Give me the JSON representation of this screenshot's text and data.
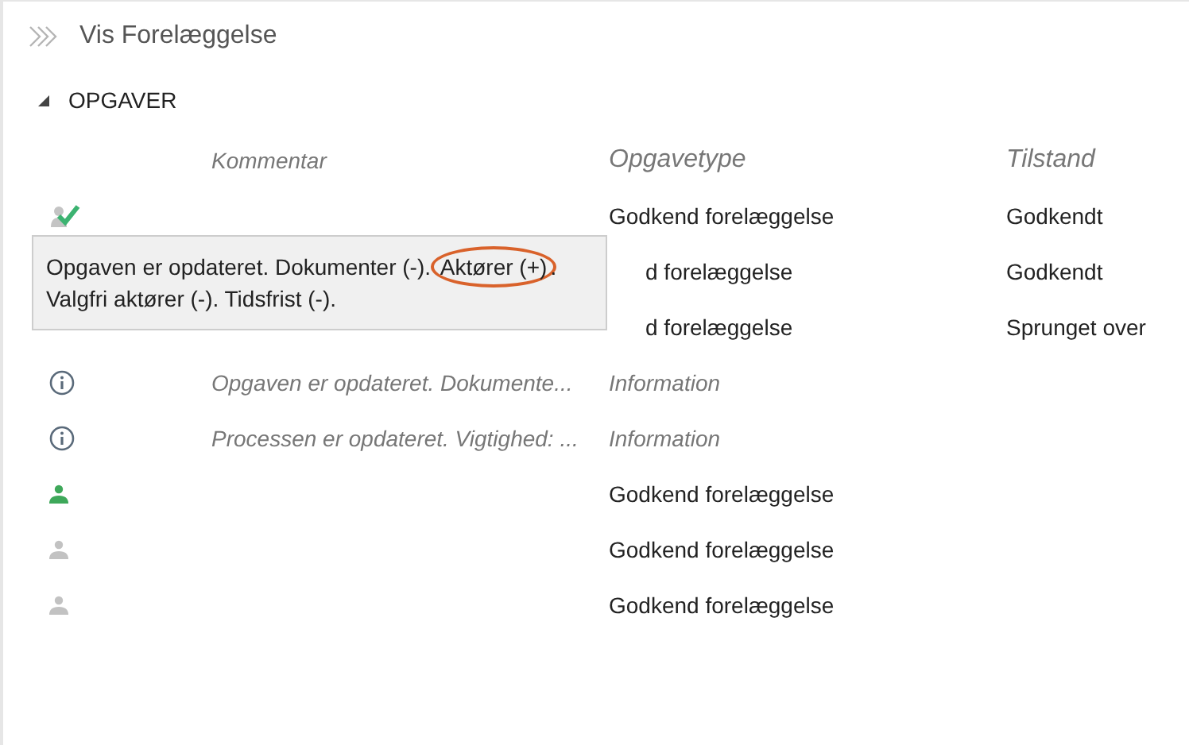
{
  "window": {
    "title": "Vis Forelæggelse"
  },
  "section": {
    "title": "OPGAVER",
    "expanded": true
  },
  "table": {
    "columns": [
      "Kommentar",
      "Opgavetype",
      "Tilstand"
    ],
    "rows": [
      {
        "kind": "approved",
        "comment": "",
        "type": "Godkend forelæggelse",
        "state": "Godkendt"
      },
      {
        "kind": "covered",
        "comment": "",
        "type": "d forelæggelse",
        "state": "Godkendt"
      },
      {
        "kind": "covered",
        "comment": "",
        "type": "d forelæggelse",
        "state": "Sprunget over"
      },
      {
        "kind": "info",
        "comment": "Opgaven er opdateret. Dokumente...",
        "type": "Information",
        "state": ""
      },
      {
        "kind": "info",
        "comment": "Processen er opdateret. Vigtighed: ...",
        "type": "Information",
        "state": ""
      },
      {
        "kind": "active",
        "comment": "",
        "type": "Godkend forelæggelse",
        "state": ""
      },
      {
        "kind": "person",
        "comment": "",
        "type": "Godkend forelæggelse",
        "state": ""
      },
      {
        "kind": "person",
        "comment": "",
        "type": "Godkend forelæggelse",
        "state": ""
      }
    ]
  },
  "tooltip": {
    "before": "Opgaven er opdateret. Dokumenter (-). ",
    "highlighted": "Aktører (+)",
    "after": ". Valgfri aktører (-). Tidsfrist (-)."
  }
}
